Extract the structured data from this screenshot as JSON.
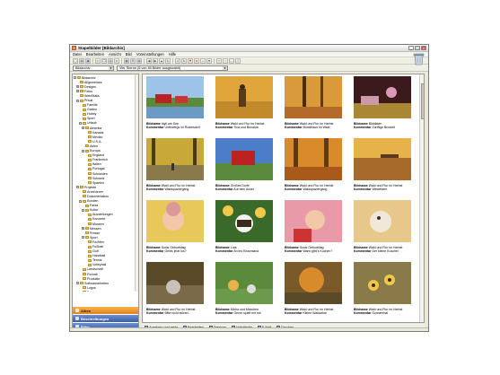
{
  "window": {
    "title": "Stapelbilder [Bildarchiv]"
  },
  "menu": [
    "Datei",
    "Bearbeiten",
    "Ansicht",
    "Bild",
    "Voreinstellungen",
    "Hilfe"
  ],
  "address": {
    "location": "Bildarchiv",
    "filter": "Vier Sterne (5 von 89 Bilder ausgewählt)"
  },
  "tree": [
    {
      "label": "Bildarchiv",
      "depth": 0,
      "exp": "-"
    },
    {
      "label": "Allgemeines",
      "depth": 1,
      "exp": ""
    },
    {
      "label": "Designs",
      "depth": 1,
      "exp": "+"
    },
    {
      "label": "Fotos",
      "depth": 1,
      "exp": "+"
    },
    {
      "label": "Web/Mails",
      "depth": 1,
      "exp": ""
    },
    {
      "label": "Privat",
      "depth": 1,
      "exp": "-"
    },
    {
      "label": "Familie",
      "depth": 2,
      "exp": ""
    },
    {
      "label": "Garten",
      "depth": 2,
      "exp": ""
    },
    {
      "label": "Hobby",
      "depth": 2,
      "exp": ""
    },
    {
      "label": "Sport",
      "depth": 2,
      "exp": ""
    },
    {
      "label": "Urlaub",
      "depth": 2,
      "exp": "-"
    },
    {
      "label": "Amerika",
      "depth": 3,
      "exp": "-"
    },
    {
      "label": "Kanada",
      "depth": 4,
      "exp": ""
    },
    {
      "label": "Mexiko",
      "depth": 4,
      "exp": ""
    },
    {
      "label": "U.S.A.",
      "depth": 4,
      "exp": ""
    },
    {
      "label": "Asien",
      "depth": 3,
      "exp": ""
    },
    {
      "label": "Europa",
      "depth": 3,
      "exp": "-"
    },
    {
      "label": "England",
      "depth": 4,
      "exp": ""
    },
    {
      "label": "Frankreich",
      "depth": 4,
      "exp": ""
    },
    {
      "label": "Italien",
      "depth": 4,
      "exp": ""
    },
    {
      "label": "Portugal",
      "depth": 4,
      "exp": ""
    },
    {
      "label": "Schweden",
      "depth": 4,
      "exp": ""
    },
    {
      "label": "Schweiz",
      "depth": 4,
      "exp": ""
    },
    {
      "label": "Spanien",
      "depth": 4,
      "exp": ""
    },
    {
      "label": "Projekte",
      "depth": 1,
      "exp": "-"
    },
    {
      "label": "Archivieren",
      "depth": 2,
      "exp": ""
    },
    {
      "label": "Dokumentation",
      "depth": 2,
      "exp": ""
    },
    {
      "label": "Kunden",
      "depth": 2,
      "exp": "-"
    },
    {
      "label": "Fanta",
      "depth": 3,
      "exp": ""
    },
    {
      "label": "Kultur",
      "depth": 3,
      "exp": "-"
    },
    {
      "label": "Ausstellungen",
      "depth": 4,
      "exp": ""
    },
    {
      "label": "Konzerte",
      "depth": 4,
      "exp": ""
    },
    {
      "label": "Museen",
      "depth": 4,
      "exp": ""
    },
    {
      "label": "Messen",
      "depth": 3,
      "exp": "+"
    },
    {
      "label": "Presse",
      "depth": 3,
      "exp": ""
    },
    {
      "label": "Sport",
      "depth": 3,
      "exp": "-"
    },
    {
      "label": "Fechten",
      "depth": 4,
      "exp": ""
    },
    {
      "label": "Fußball",
      "depth": 4,
      "exp": ""
    },
    {
      "label": "Golf",
      "depth": 4,
      "exp": ""
    },
    {
      "label": "Handball",
      "depth": 4,
      "exp": ""
    },
    {
      "label": "Tennis",
      "depth": 4,
      "exp": ""
    },
    {
      "label": "Volleyball",
      "depth": 4,
      "exp": ""
    },
    {
      "label": "Landschaft",
      "depth": 2,
      "exp": ""
    },
    {
      "label": "Portrait",
      "depth": 2,
      "exp": ""
    },
    {
      "label": "Produkte",
      "depth": 2,
      "exp": ""
    },
    {
      "label": "Softwarearbeiten",
      "depth": 1,
      "exp": "-"
    },
    {
      "label": "Logos",
      "depth": 2,
      "exp": ""
    },
    {
      "label": "Setups",
      "depth": 2,
      "exp": ""
    }
  ],
  "panels": [
    "Alben",
    "Beschreibungen",
    "Filter"
  ],
  "images": [
    {
      "name": "Idyll am See",
      "comment": "Unterwegs im Rodelsdorf"
    },
    {
      "name": "Wald und Flur im Herbst",
      "comment": "Tina und Bonaida"
    },
    {
      "name": "Wald und Flur im Herbst",
      "comment": "Bootshaus im Wald"
    },
    {
      "name": "Bilddaten",
      "comment": "Zünftige Brotzeit"
    },
    {
      "name": "Wald und Flur im Herbst",
      "comment": "Waldspaziergang"
    },
    {
      "name": "Großes Dorfe",
      "comment": "Auf dem Acker"
    },
    {
      "name": "Wald und Flur im Herbst",
      "comment": "Waldspaziergang"
    },
    {
      "name": "Wald und Flur im Herbst",
      "comment": "Weidefarm"
    },
    {
      "name": "Susis Geburtstag",
      "comment": "Gehts jetzt los?"
    },
    {
      "name": "Luta",
      "comment": "An leo Kissenland"
    },
    {
      "name": "Susis Geburtstag",
      "comment": "Wann gibt's Kuchen?"
    },
    {
      "name": "Wald und Flur im Herbst",
      "comment": "Der kleine Kuschel"
    },
    {
      "name": "Wald und Flur im Herbst",
      "comment": "Bitte nicht stören!"
    },
    {
      "name": "Micha und Maxchen",
      "comment": "Gerne spielt mit mir"
    },
    {
      "name": "Wald und Flur im Herbst",
      "comment": "Kleine Waldarbar"
    },
    {
      "name": "Wald und Flur im Herbst",
      "comment": "Sonnenmal"
    }
  ],
  "labels": {
    "name": "Bildname",
    "comment": "Kommentar"
  },
  "bottom": [
    "Anzeigen und mehr",
    "Bearbeiten",
    "Diashow",
    "Vollständig",
    "E-Mail",
    "Drucken"
  ]
}
